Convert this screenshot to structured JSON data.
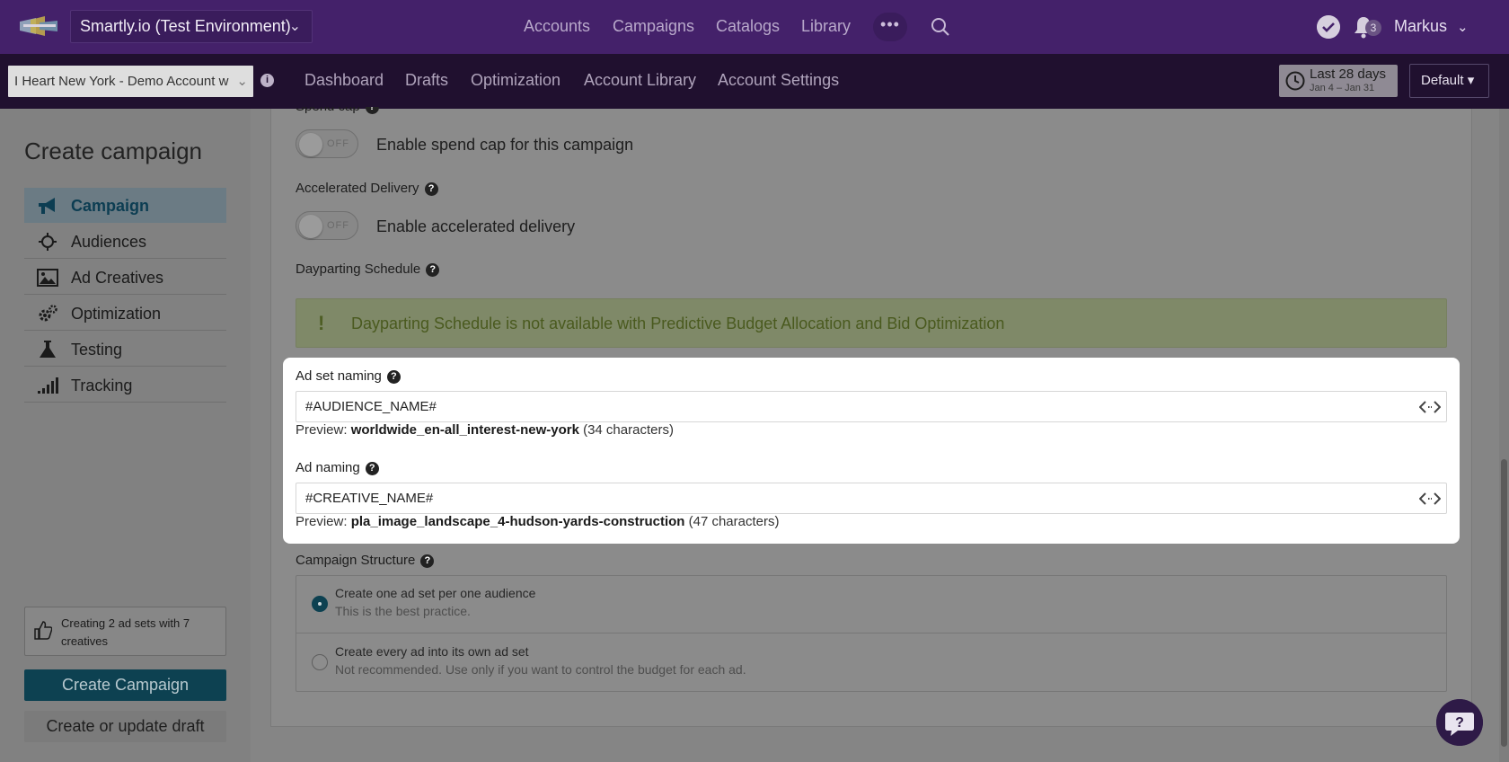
{
  "topbar": {
    "environment": "Smartly.io (Test Environment)",
    "nav": [
      "Accounts",
      "Campaigns",
      "Catalogs",
      "Library"
    ],
    "more_label": "•••",
    "notification_count": "3",
    "user": "Markus"
  },
  "subbar": {
    "account": "I Heart New York - Demo Account w",
    "nav": [
      "Dashboard",
      "Drafts",
      "Optimization",
      "Account Library",
      "Account Settings"
    ],
    "date_range_title": "Last 28 days",
    "date_range_sub": "Jan 4 – Jan 31",
    "view": "Default ▾"
  },
  "sidebar": {
    "title": "Create campaign",
    "items": [
      {
        "label": "Campaign",
        "icon": "megaphone-icon",
        "active": true
      },
      {
        "label": "Audiences",
        "icon": "crosshair-icon"
      },
      {
        "label": "Ad Creatives",
        "icon": "image-icon"
      },
      {
        "label": "Optimization",
        "icon": "gears-icon"
      },
      {
        "label": "Testing",
        "icon": "flask-icon"
      },
      {
        "label": "Tracking",
        "icon": "signal-bars-icon"
      }
    ],
    "summary": "Creating 2 ad sets with 7 creatives",
    "create_button": "Create Campaign",
    "draft_button": "Create or update draft"
  },
  "form": {
    "spend_cap_partial": "Spend cap",
    "spend_cap_toggle": "OFF",
    "spend_cap_label": "Enable spend cap for this campaign",
    "accelerated_label": "Accelerated Delivery",
    "accelerated_toggle": "OFF",
    "accelerated_toggle_label": "Enable accelerated delivery",
    "dayparting_label": "Dayparting Schedule",
    "dayparting_alert": "Dayparting Schedule is not available with Predictive Budget Allocation and Bid Optimization",
    "adset_naming": {
      "label": "Ad set naming",
      "value": "#AUDIENCE_NAME#",
      "preview_prefix": "Preview: ",
      "preview_value": "worldwide_en-all_interest-new-york",
      "preview_count": " (34 characters)"
    },
    "ad_naming": {
      "label": "Ad naming",
      "value": "#CREATIVE_NAME#",
      "preview_prefix": "Preview: ",
      "preview_value": "pla_image_landscape_4-hudson-yards-construction",
      "preview_count": " (47 characters)"
    },
    "structure_label": "Campaign Structure",
    "structure_options": [
      {
        "title": "Create one ad set per one audience",
        "sub": "This is the best practice.",
        "selected": true
      },
      {
        "title": "Create every ad into its own ad set",
        "sub": "Not recommended. Use only if you want to control the budget for each ad.",
        "selected": false
      }
    ]
  },
  "colors": {
    "topbar": "#44216a",
    "subbar": "#20102f",
    "primary_button": "#0d4151",
    "alert_text": "#4a5a1f"
  }
}
